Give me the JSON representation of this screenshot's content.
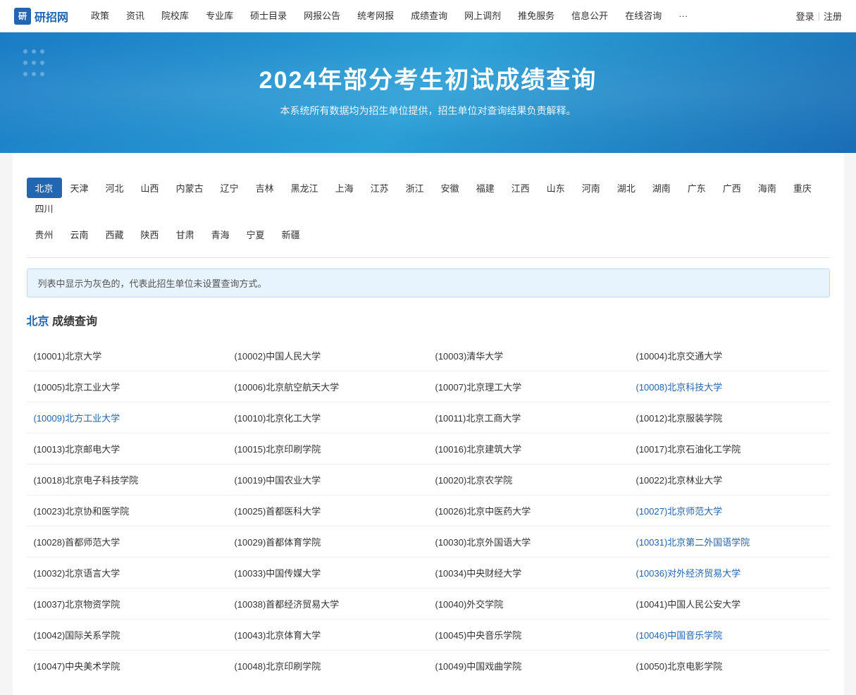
{
  "navbar": {
    "logo_icon": "研",
    "logo_text": "研招网",
    "menu_items": [
      {
        "label": "政策",
        "href": "#"
      },
      {
        "label": "资讯",
        "href": "#"
      },
      {
        "label": "院校库",
        "href": "#"
      },
      {
        "label": "专业库",
        "href": "#"
      },
      {
        "label": "硕士目录",
        "href": "#"
      },
      {
        "label": "网报公告",
        "href": "#"
      },
      {
        "label": "统考网报",
        "href": "#"
      },
      {
        "label": "成绩查询",
        "href": "#"
      },
      {
        "label": "网上调剂",
        "href": "#"
      },
      {
        "label": "推免服务",
        "href": "#"
      },
      {
        "label": "信息公开",
        "href": "#"
      },
      {
        "label": "在线咨询",
        "href": "#"
      },
      {
        "label": "···",
        "href": "#"
      }
    ],
    "login": "登录",
    "separator": "|",
    "register": "注册"
  },
  "hero": {
    "title": "2024年部分考生初试成绩查询",
    "subtitle": "本系统所有数据均为招生单位提供，招生单位对查询结果负责解释。"
  },
  "notice": "列表中显示为灰色的，代表此招生单位未设置查询方式。",
  "section_title_prefix": "北京",
  "section_title_suffix": "成绩查询",
  "provinces_row1": [
    {
      "label": "北京",
      "active": true
    },
    {
      "label": "天津",
      "active": false
    },
    {
      "label": "河北",
      "active": false
    },
    {
      "label": "山西",
      "active": false
    },
    {
      "label": "内蒙古",
      "active": false
    },
    {
      "label": "辽宁",
      "active": false
    },
    {
      "label": "吉林",
      "active": false
    },
    {
      "label": "黑龙江",
      "active": false
    },
    {
      "label": "上海",
      "active": false
    },
    {
      "label": "江苏",
      "active": false
    },
    {
      "label": "浙江",
      "active": false
    },
    {
      "label": "安徽",
      "active": false
    },
    {
      "label": "福建",
      "active": false
    },
    {
      "label": "江西",
      "active": false
    },
    {
      "label": "山东",
      "active": false
    },
    {
      "label": "河南",
      "active": false
    },
    {
      "label": "湖北",
      "active": false
    },
    {
      "label": "湖南",
      "active": false
    },
    {
      "label": "广东",
      "active": false
    },
    {
      "label": "广西",
      "active": false
    },
    {
      "label": "海南",
      "active": false
    },
    {
      "label": "重庆",
      "active": false
    },
    {
      "label": "四川",
      "active": false
    }
  ],
  "provinces_row2": [
    {
      "label": "贵州",
      "active": false
    },
    {
      "label": "云南",
      "active": false
    },
    {
      "label": "西藏",
      "active": false
    },
    {
      "label": "陕西",
      "active": false
    },
    {
      "label": "甘肃",
      "active": false
    },
    {
      "label": "青海",
      "active": false
    },
    {
      "label": "宁夏",
      "active": false
    },
    {
      "label": "新疆",
      "active": false
    }
  ],
  "universities": [
    [
      {
        "code": "10001",
        "name": "北京大学",
        "link": false
      },
      {
        "code": "10002",
        "name": "中国人民大学",
        "link": false
      },
      {
        "code": "10003",
        "name": "清华大学",
        "link": false
      },
      {
        "code": "10004",
        "name": "北京交通大学",
        "link": false
      }
    ],
    [
      {
        "code": "10005",
        "name": "北京工业大学",
        "link": false
      },
      {
        "code": "10006",
        "name": "北京航空航天大学",
        "link": false
      },
      {
        "code": "10007",
        "name": "北京理工大学",
        "link": false
      },
      {
        "code": "10008",
        "name": "北京科技大学",
        "link": true
      }
    ],
    [
      {
        "code": "10009",
        "name": "北方工业大学",
        "link": true
      },
      {
        "code": "10010",
        "name": "北京化工大学",
        "link": false
      },
      {
        "code": "10011",
        "name": "北京工商大学",
        "link": false
      },
      {
        "code": "10012",
        "name": "北京服装学院",
        "link": false
      }
    ],
    [
      {
        "code": "10013",
        "name": "北京邮电大学",
        "link": false
      },
      {
        "code": "10015",
        "name": "北京印刷学院",
        "link": false
      },
      {
        "code": "10016",
        "name": "北京建筑大学",
        "link": false
      },
      {
        "code": "10017",
        "name": "北京石油化工学院",
        "link": false
      }
    ],
    [
      {
        "code": "10018",
        "name": "北京电子科技学院",
        "link": false
      },
      {
        "code": "10019",
        "name": "中国农业大学",
        "link": false
      },
      {
        "code": "10020",
        "name": "北京农学院",
        "link": false
      },
      {
        "code": "10022",
        "name": "北京林业大学",
        "link": false
      }
    ],
    [
      {
        "code": "10023",
        "name": "北京协和医学院",
        "link": false
      },
      {
        "code": "10025",
        "name": "首都医科大学",
        "link": false
      },
      {
        "code": "10026",
        "name": "北京中医药大学",
        "link": false
      },
      {
        "code": "10027",
        "name": "北京师范大学",
        "link": true
      }
    ],
    [
      {
        "code": "10028",
        "name": "首都师范大学",
        "link": false
      },
      {
        "code": "10029",
        "name": "首都体育学院",
        "link": false
      },
      {
        "code": "10030",
        "name": "北京外国语大学",
        "link": false
      },
      {
        "code": "10031",
        "name": "北京第二外国语学院",
        "link": true
      }
    ],
    [
      {
        "code": "10032",
        "name": "北京语言大学",
        "link": false
      },
      {
        "code": "10033",
        "name": "中国传媒大学",
        "link": false
      },
      {
        "code": "10034",
        "name": "中央财经大学",
        "link": false
      },
      {
        "code": "10036",
        "name": "对外经济贸易大学",
        "link": true
      }
    ],
    [
      {
        "code": "10037",
        "name": "北京物资学院",
        "link": false
      },
      {
        "code": "10038",
        "name": "首都经济贸易大学",
        "link": false
      },
      {
        "code": "10040",
        "name": "外交学院",
        "link": false
      },
      {
        "code": "10041",
        "name": "中国人民公安大学",
        "link": false
      }
    ],
    [
      {
        "code": "10042",
        "name": "国际关系学院",
        "link": false
      },
      {
        "code": "10043",
        "name": "北京体育大学",
        "link": false
      },
      {
        "code": "10045",
        "name": "中央音乐学院",
        "link": false
      },
      {
        "code": "10046",
        "name": "中国音乐学院",
        "link": true
      }
    ],
    [
      {
        "code": "10047",
        "name": "中央美术学院",
        "link": false
      },
      {
        "code": "10048",
        "name": "北京印刷学院",
        "link": false
      },
      {
        "code": "10049",
        "name": "中国戏曲学院",
        "link": false
      },
      {
        "code": "10050",
        "name": "北京电影学院",
        "link": false
      }
    ]
  ]
}
